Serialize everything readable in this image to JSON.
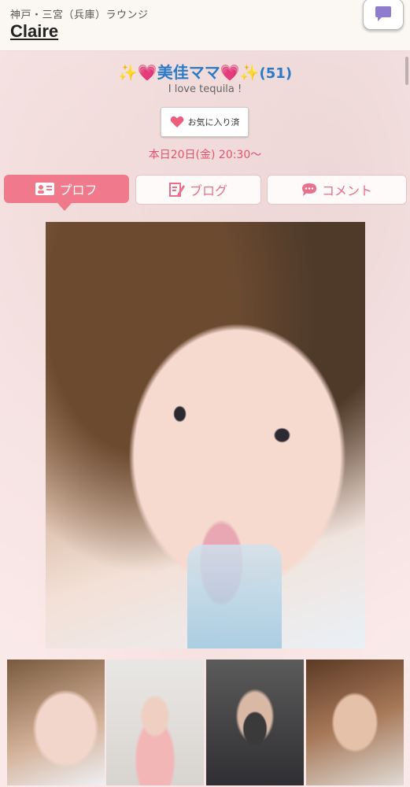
{
  "header": {
    "area": "神戸・三宮（兵庫）ラウンジ",
    "shop_name": "Claire",
    "chat_icon": "chat-bubble-icon"
  },
  "profile": {
    "name": "✨💗美佳ママ💗✨",
    "age": "(51)",
    "comment": "I love tequila !",
    "favorite_label": "お気に入り済",
    "schedule": "本日20日(金) 20:30〜"
  },
  "tabs": [
    {
      "label": "プロフ",
      "icon": "profile-card-icon",
      "active": true
    },
    {
      "label": "ブログ",
      "icon": "blog-edit-icon",
      "active": false
    },
    {
      "label": "コメント",
      "icon": "comment-bubble-icon",
      "active": false
    }
  ],
  "colors": {
    "accent_pink": "#f07a8c",
    "name_blue": "#2a7ac8",
    "schedule_red": "#e0546c"
  }
}
